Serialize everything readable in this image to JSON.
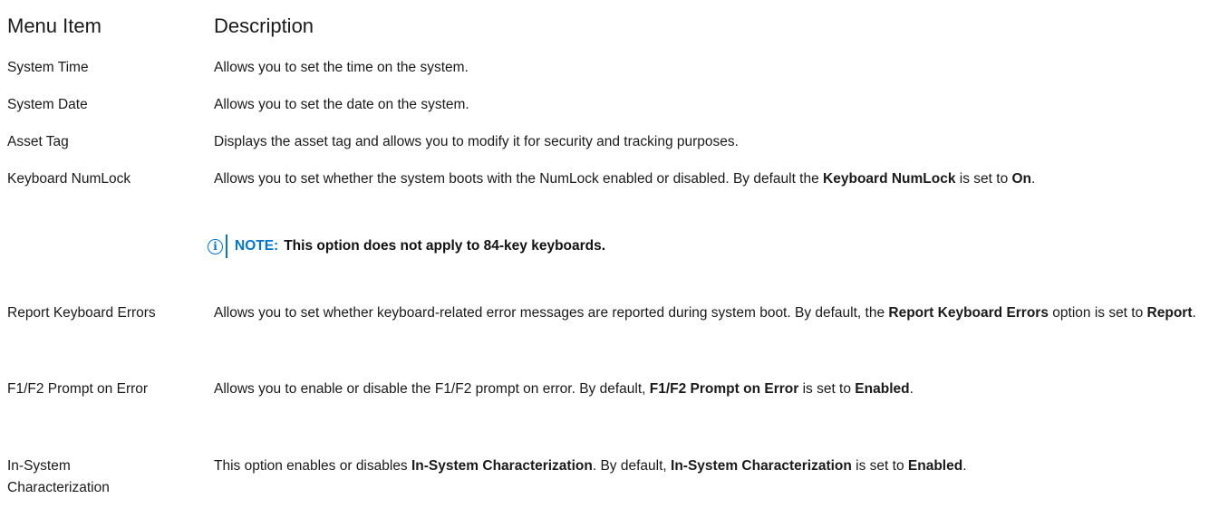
{
  "header": {
    "menu_item": "Menu Item",
    "description": "Description"
  },
  "rows": [
    {
      "item": "System Time",
      "desc": [
        "Allows you to set the time on the system."
      ]
    },
    {
      "item": "System Date",
      "desc": [
        "Allows you to set the date on the system."
      ]
    },
    {
      "item": "Asset Tag",
      "desc": [
        "Displays the asset tag and allows you to modify it for security and tracking purposes."
      ]
    },
    {
      "item": "Keyboard NumLock",
      "desc": [
        "Allows you to set whether the system boots with the NumLock enabled or disabled. By default the ",
        "Keyboard NumLock",
        " is set to ",
        "On",
        "."
      ],
      "note": {
        "label": "NOTE:",
        "text": "This option does not apply to 84-key keyboards."
      }
    },
    {
      "item": "Report Keyboard Errors",
      "desc": [
        "Allows you to set whether keyboard-related error messages are reported during system boot. By default, the ",
        "Report Keyboard Errors",
        " option is set to ",
        "Report",
        "."
      ]
    },
    {
      "item": "F1/F2 Prompt on Error",
      "desc": [
        "Allows you to enable or disable the F1/F2 prompt on error. By default, ",
        "F1/F2 Prompt on Error",
        " is set to ",
        "Enabled",
        "."
      ]
    },
    {
      "item": "In-System Characterization",
      "desc": [
        "This option enables or disables ",
        "In-System Characterization",
        ". By default, ",
        "In-System Characterization",
        " is set to ",
        "Enabled",
        "."
      ]
    }
  ],
  "icons": {
    "note_icon": "info-icon",
    "accent_color": "#0076ce"
  }
}
